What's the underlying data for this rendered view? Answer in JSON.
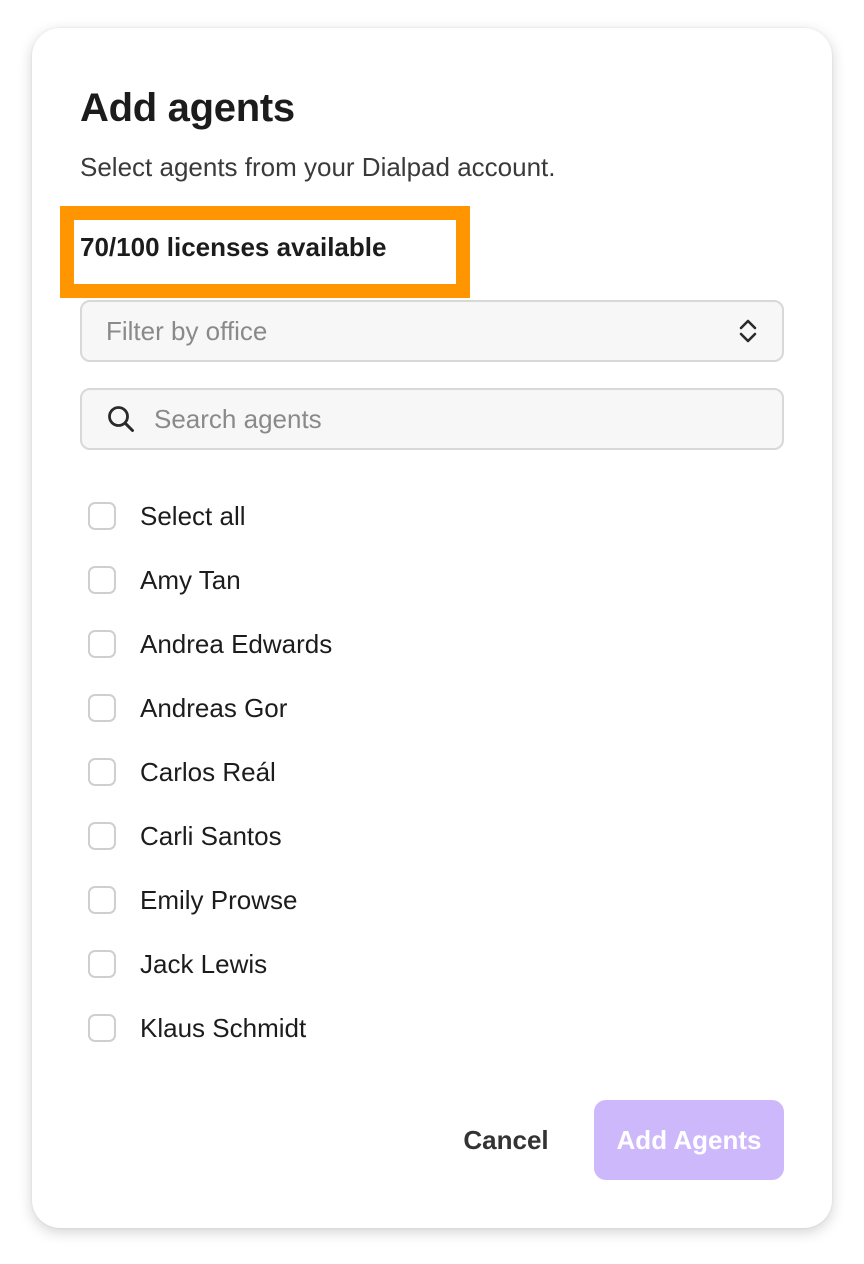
{
  "dialog": {
    "title": "Add agents",
    "subtitle": "Select agents from your Dialpad account.",
    "licenses_text": "70/100 licenses available",
    "highlight_color": "#FF9500"
  },
  "filter": {
    "placeholder": "Filter by office",
    "icon": "chevron-up-down-icon"
  },
  "search": {
    "placeholder": "Search agents",
    "icon": "search-icon"
  },
  "select_all": {
    "label": "Select all",
    "checked": false
  },
  "agents": [
    {
      "name": "Amy Tan",
      "checked": false
    },
    {
      "name": "Andrea Edwards",
      "checked": false
    },
    {
      "name": "Andreas Gor",
      "checked": false
    },
    {
      "name": "Carlos Reál",
      "checked": false
    },
    {
      "name": "Carli Santos",
      "checked": false
    },
    {
      "name": "Emily Prowse",
      "checked": false
    },
    {
      "name": "Jack Lewis",
      "checked": false
    },
    {
      "name": "Klaus Schmidt",
      "checked": false
    }
  ],
  "actions": {
    "cancel_label": "Cancel",
    "add_label": "Add Agents",
    "add_disabled": true,
    "add_color": "#CDB8FC"
  }
}
